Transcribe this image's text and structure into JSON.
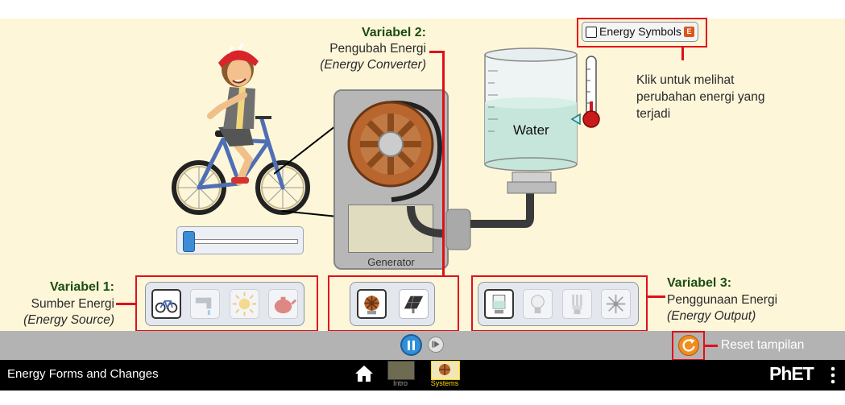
{
  "app_title": "Energy Forms and Changes",
  "variable1": {
    "title": "Variabel 1:",
    "name": "Sumber Energi",
    "english": "(Energy Source)"
  },
  "variable2": {
    "title": "Variabel 2:",
    "name": "Pengubah Energi",
    "english": "(Energy Converter)"
  },
  "variable3": {
    "title": "Variabel 3:",
    "name": "Penggunaan Energi",
    "english": "(Energy Output)"
  },
  "energy_symbols": {
    "label": "Energy Symbols",
    "key": "E",
    "checked": false
  },
  "hint": {
    "line1": "Klik untuk melihat",
    "line2": "perubahan energi yang",
    "line3": "terjadi"
  },
  "reset_label": "Reset tampilan",
  "water_label": "Water",
  "generator_label": "Generator",
  "screens": [
    {
      "label": "Intro"
    },
    {
      "label": "Systems"
    }
  ],
  "brand": "PhET",
  "pedal_slider_value": 0.02,
  "colors": {
    "accent_red": "#e0101a",
    "heading_green": "#1d4d12",
    "sim_bg": "#fdf6d9",
    "control_bar": "#b3b3b3",
    "pause_blue": "#2f8fd8",
    "reset_orange": "#f28c1c"
  }
}
